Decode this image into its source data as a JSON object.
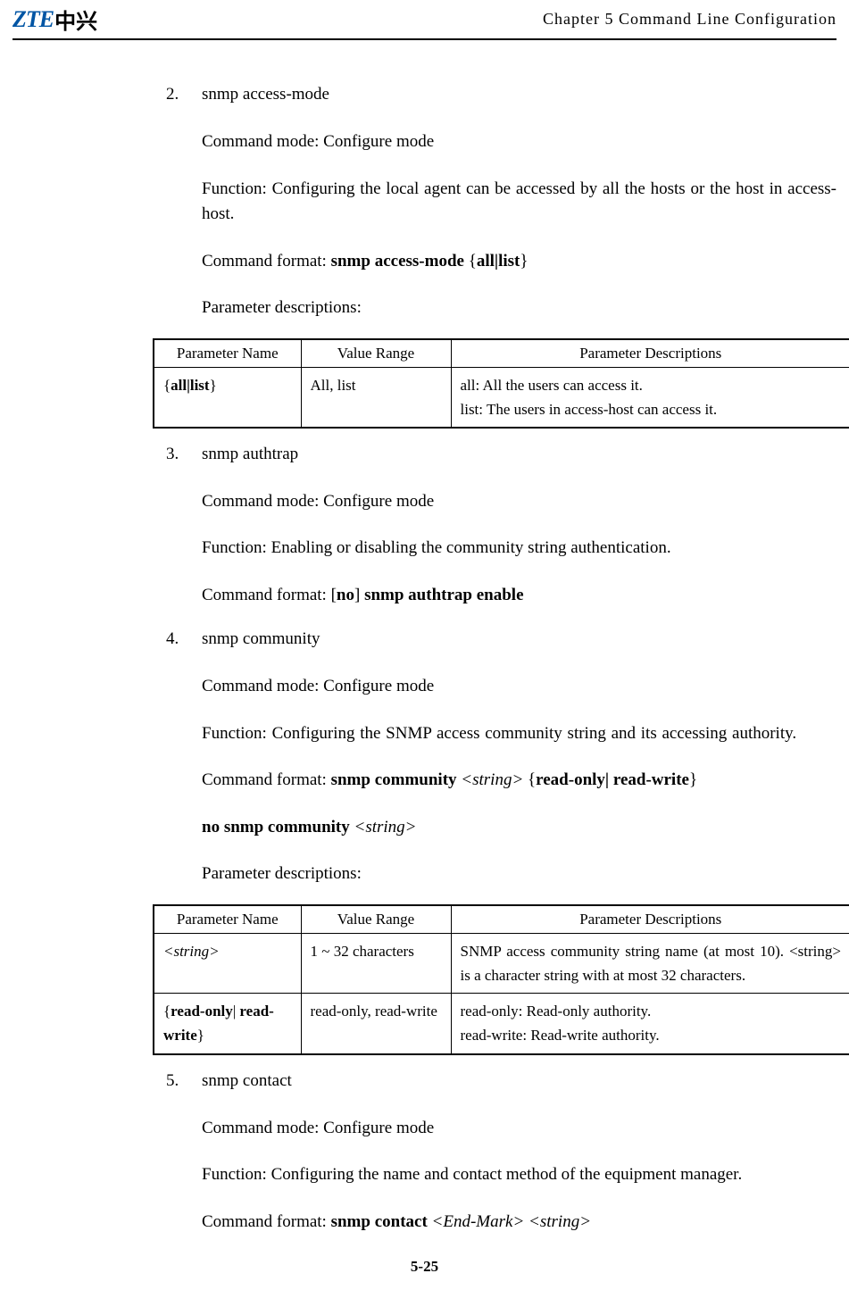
{
  "header": {
    "logo_text_latin": "ZTE",
    "logo_text_cn": "中兴",
    "chapter": "Chapter 5 Command Line Configuration"
  },
  "items": [
    {
      "num": "2.",
      "title": "snmp access-mode",
      "mode_label": "Command mode: Configure mode",
      "function": "Function: Configuring the local agent can be accessed by all the hosts or the host in access-host.",
      "format_prefix": "Command format: ",
      "format_cmd": "snmp access-mode ",
      "format_suffix": "{",
      "format_bold2": "all|list",
      "format_suffix2": "}",
      "param_label": "Parameter descriptions:",
      "table": true
    },
    {
      "num": "3.",
      "title": "snmp authtrap",
      "mode_label": "Command mode: Configure mode",
      "function": "Function: Enabling or disabling the community string authentication.",
      "format_prefix": "Command format: [",
      "format_cmd": "no",
      "format_mid": "] ",
      "format_cmd2": "snmp authtrap enable"
    },
    {
      "num": "4.",
      "title": "snmp community",
      "mode_label": "Command mode: Configure mode",
      "function": "Function: Configuring the SNMP access community string and its accessing authority.",
      "format_prefix": "Command format: ",
      "format_cmd": "snmp community ",
      "format_var": "<string>",
      "format_suffix": " {",
      "format_bold2": "read-only| read-write",
      "format_suffix2": "}",
      "no_cmd_bold": "no snmp community ",
      "no_cmd_var": "<string>",
      "param_label": "Parameter descriptions:",
      "table": true
    },
    {
      "num": "5.",
      "title": "snmp contact",
      "mode_label": "Command mode: Configure mode",
      "function": "Function: Configuring the name and contact method of the equipment manager.",
      "format_prefix": "Command format: ",
      "format_cmd": "snmp contact ",
      "format_var": "<End-Mark> <string>"
    }
  ],
  "table1": {
    "headers": [
      "Parameter Name",
      "Value Range",
      "Parameter Descriptions"
    ],
    "rows": [
      {
        "name_open": "{",
        "name_bold": "all|list",
        "name_close": "}",
        "range": "All, list",
        "desc1": "all: All the users can access it.",
        "desc2": "list: The users in access-host can access it."
      }
    ]
  },
  "table2": {
    "headers": [
      "Parameter Name",
      "Value Range",
      "Parameter Descriptions"
    ],
    "rows": [
      {
        "name_var": "<string>",
        "range": "1 ~ 32 characters",
        "desc": "SNMP access community string name (at most 10). <string> is a character string with at most 32 characters."
      },
      {
        "name_open": "{",
        "name_bold1": "read-only",
        "name_pipe": "|",
        "name_bold2": " read-write",
        "name_close": "}",
        "range": "read-only, read-write",
        "desc1": "read-only: Read-only authority.",
        "desc2": "read-write: Read-write authority."
      }
    ]
  },
  "footer": "5-25"
}
